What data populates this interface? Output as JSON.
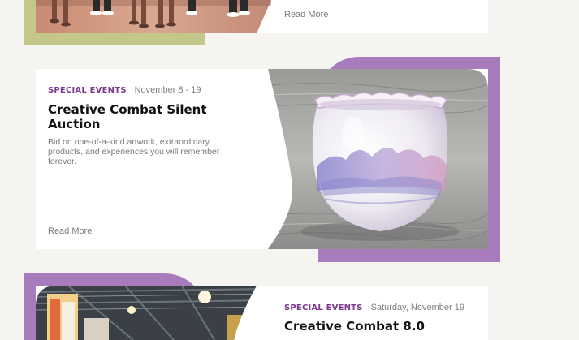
{
  "colors": {
    "page_bg": "#f6f4f0",
    "accent_green": "#c5c689",
    "accent_purple": "#a87bbd",
    "category": "#7b3a8e"
  },
  "cards": [
    {
      "read_more": "Read More"
    },
    {
      "category": "SPECIAL EVENTS",
      "date": "November 8 - 19",
      "title": "Creative Combat Silent Auction",
      "description": "Bid on one-of-a-kind artwork, extraordinary products, and experiences you will remember forever.",
      "read_more": "Read More",
      "image_alt": "Ceramic bowl with purple landscape glaze"
    },
    {
      "category": "SPECIAL EVENTS",
      "date": "Saturday, November 19",
      "title": "Creative Combat 8.0",
      "image_alt": "Event hall with artwork"
    }
  ]
}
